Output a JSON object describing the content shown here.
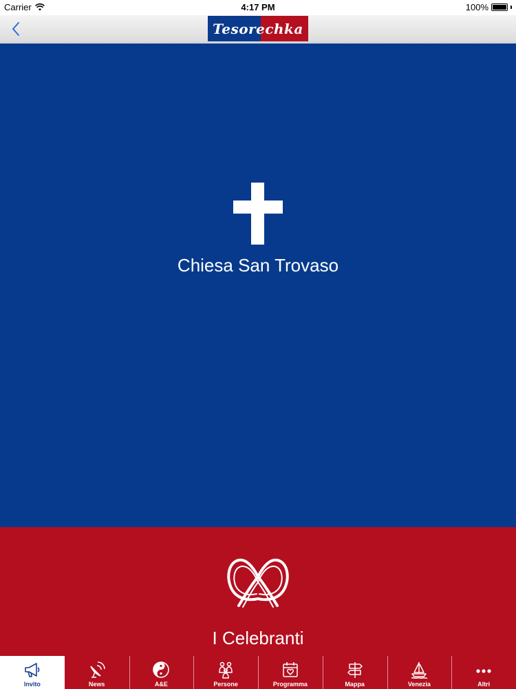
{
  "status_bar": {
    "carrier": "Carrier",
    "time": "4:17 PM",
    "battery": "100%",
    "wifi_icon": "wifi-icon",
    "battery_icon": "battery-icon"
  },
  "nav_bar": {
    "back_icon": "chevron-left-icon",
    "logo_text": "Tesorechka"
  },
  "venue": {
    "icon": "cross-icon",
    "label": "Chiesa San Trovaso"
  },
  "celebrants": {
    "icon": "pretzel-icon",
    "label": "I Celebranti"
  },
  "tab_bar": {
    "active_index": 0,
    "tabs": [
      {
        "label": "Invito",
        "icon": "megaphone-icon"
      },
      {
        "label": "News",
        "icon": "satellite-dish-icon"
      },
      {
        "label": "A&E",
        "icon": "yin-yang-icon"
      },
      {
        "label": "Persone",
        "icon": "people-icon"
      },
      {
        "label": "Programma",
        "icon": "calendar-heart-icon"
      },
      {
        "label": "Mappa",
        "icon": "signpost-icon"
      },
      {
        "label": "Venezia",
        "icon": "sailboat-icon"
      },
      {
        "label": "Altri",
        "icon": "more-icon"
      }
    ]
  },
  "colors": {
    "blue": "#073a8c",
    "red": "#b30f1f",
    "active_tab_text": "#1a3f8f"
  }
}
